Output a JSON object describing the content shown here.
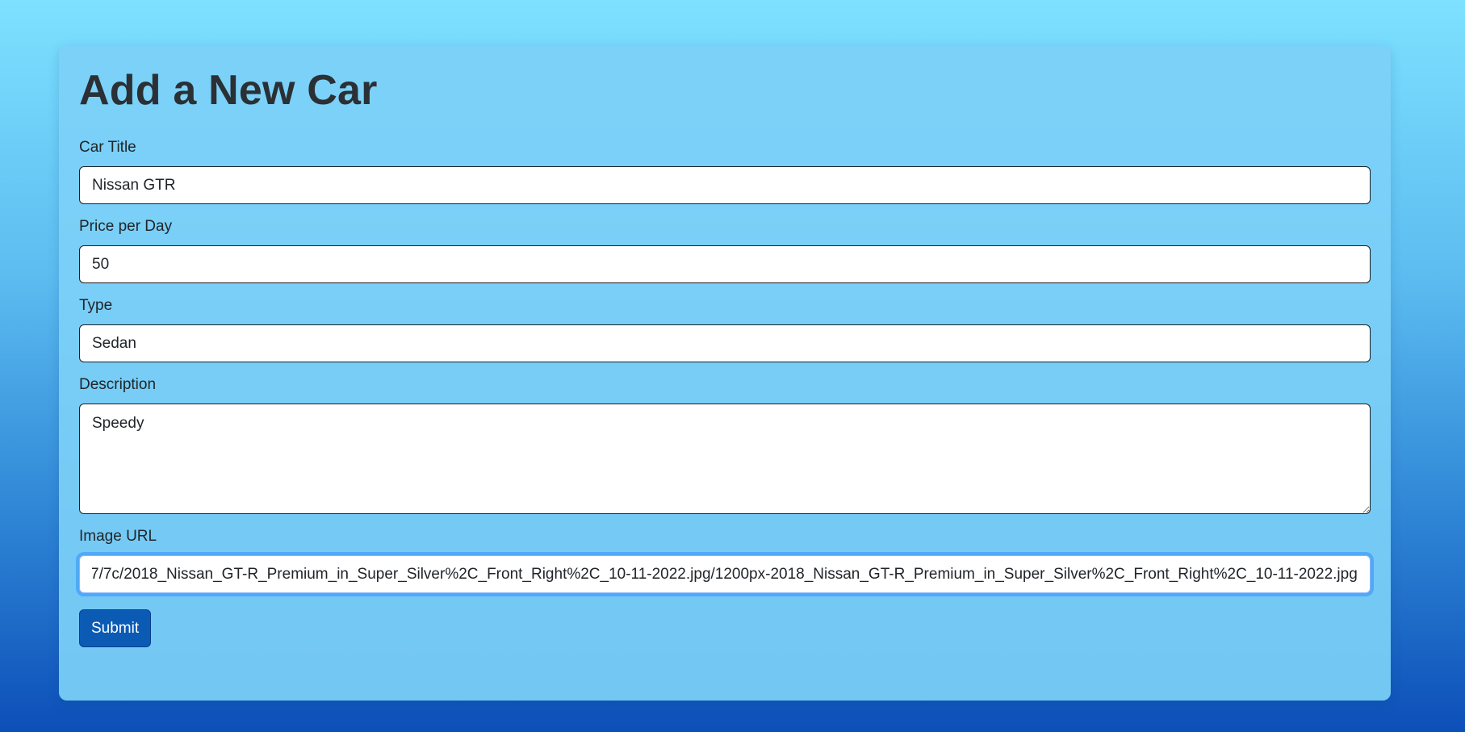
{
  "page": {
    "title": "Add a New Car"
  },
  "form": {
    "car_title": {
      "label": "Car Title",
      "value": "Nissan GTR"
    },
    "price_per_day": {
      "label": "Price per Day",
      "value": "50"
    },
    "type": {
      "label": "Type",
      "value": "Sedan"
    },
    "description": {
      "label": "Description",
      "value": "Speedy"
    },
    "image_url": {
      "label": "Image URL",
      "value": "7/7c/2018_Nissan_GT-R_Premium_in_Super_Silver%2C_Front_Right%2C_10-11-2022.jpg/1200px-2018_Nissan_GT-R_Premium_in_Super_Silver%2C_Front_Right%2C_10-11-2022.jpg"
    },
    "submit_label": "Submit"
  },
  "colors": {
    "background_top": "#7de1ff",
    "background_bottom": "#0c4fb8",
    "card": "#7cd0f7",
    "primary_button": "#0b5bb5",
    "focus_ring": "#86b7fe"
  }
}
